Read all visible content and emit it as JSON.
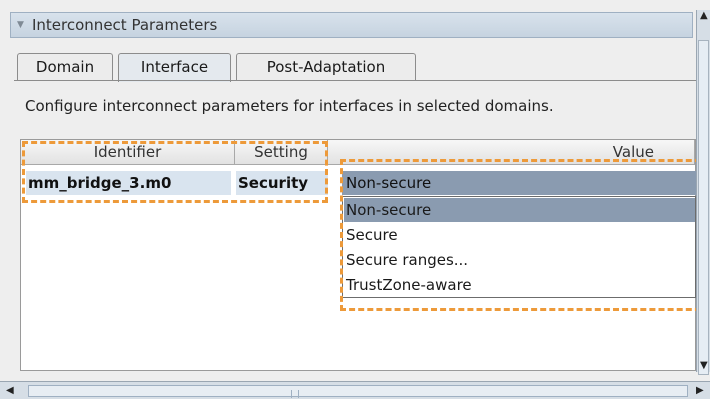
{
  "panel": {
    "title": "Interconnect Parameters",
    "collapse_icon": "triangle-down-icon"
  },
  "tabs": [
    {
      "label": "Domain"
    },
    {
      "label": "Interface"
    },
    {
      "label": "Post-Adaptation"
    }
  ],
  "description": "Configure interconnect parameters for interfaces in selected domains.",
  "table": {
    "columns": [
      "Identifier",
      "Setting",
      "Value"
    ],
    "rows": [
      {
        "identifier": "mm_bridge_3.m0",
        "setting": "Security",
        "value": "Non-secure"
      }
    ]
  },
  "dropdown": {
    "selected": "Non-secure",
    "options": [
      "Non-secure",
      "Secure",
      "Secure ranges...",
      "TrustZone-aware"
    ]
  },
  "colors": {
    "highlight": "#ed9a3a",
    "selection": "#8a9bb0",
    "header": "#c6d3e0"
  }
}
